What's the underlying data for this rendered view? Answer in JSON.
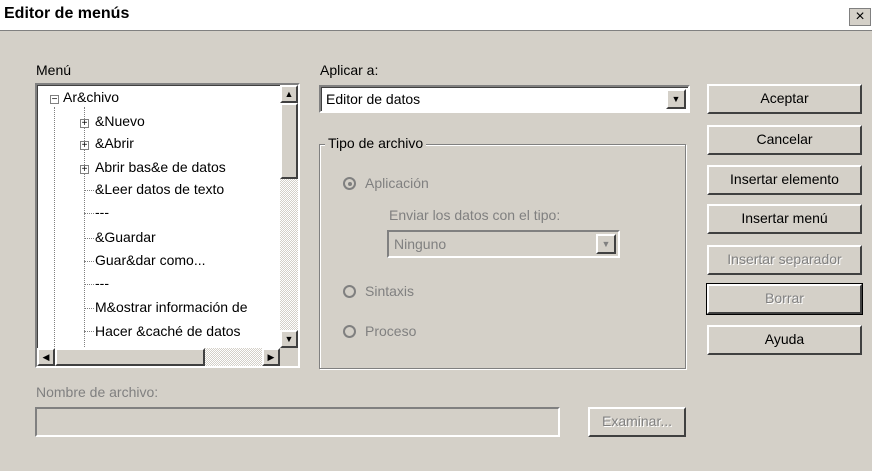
{
  "window": {
    "title": "Editor de menús",
    "close_glyph": "×"
  },
  "menu": {
    "label": "Menú",
    "tree": [
      {
        "label": "Ar&chivo",
        "level": 0,
        "expander": "−"
      },
      {
        "label": "&Nuevo",
        "level": 1,
        "expander": "+"
      },
      {
        "label": "&Abrir",
        "level": 1,
        "expander": "+"
      },
      {
        "label": "Abrir bas&e de datos",
        "level": 1,
        "expander": "+"
      },
      {
        "label": "&Leer datos de texto",
        "level": 1,
        "expander": ""
      },
      {
        "label": "---",
        "level": 1,
        "expander": ""
      },
      {
        "label": "&Guardar",
        "level": 1,
        "expander": ""
      },
      {
        "label": "Guar&dar como...",
        "level": 1,
        "expander": ""
      },
      {
        "label": "---",
        "level": 1,
        "expander": ""
      },
      {
        "label": "M&ostrar información de",
        "level": 1,
        "expander": ""
      },
      {
        "label": "Hacer &caché de datos",
        "level": 1,
        "expander": ""
      }
    ]
  },
  "apply_to": {
    "label": "Aplicar a:",
    "selected": "Editor de datos"
  },
  "file_type": {
    "legend": "Tipo de archivo",
    "options": [
      "Aplicación",
      "Sintaxis",
      "Proceso"
    ],
    "send_label": "Enviar los datos con el tipo:",
    "send_selected": "Ninguno"
  },
  "filename": {
    "label": "Nombre de archivo:",
    "value": "",
    "browse_label": "Examinar..."
  },
  "buttons": {
    "accept": "Aceptar",
    "cancel": "Cancelar",
    "insert_item": "Insertar elemento",
    "insert_menu": "Insertar menú",
    "insert_separator": "Insertar separador",
    "delete": "Borrar",
    "help": "Ayuda"
  }
}
